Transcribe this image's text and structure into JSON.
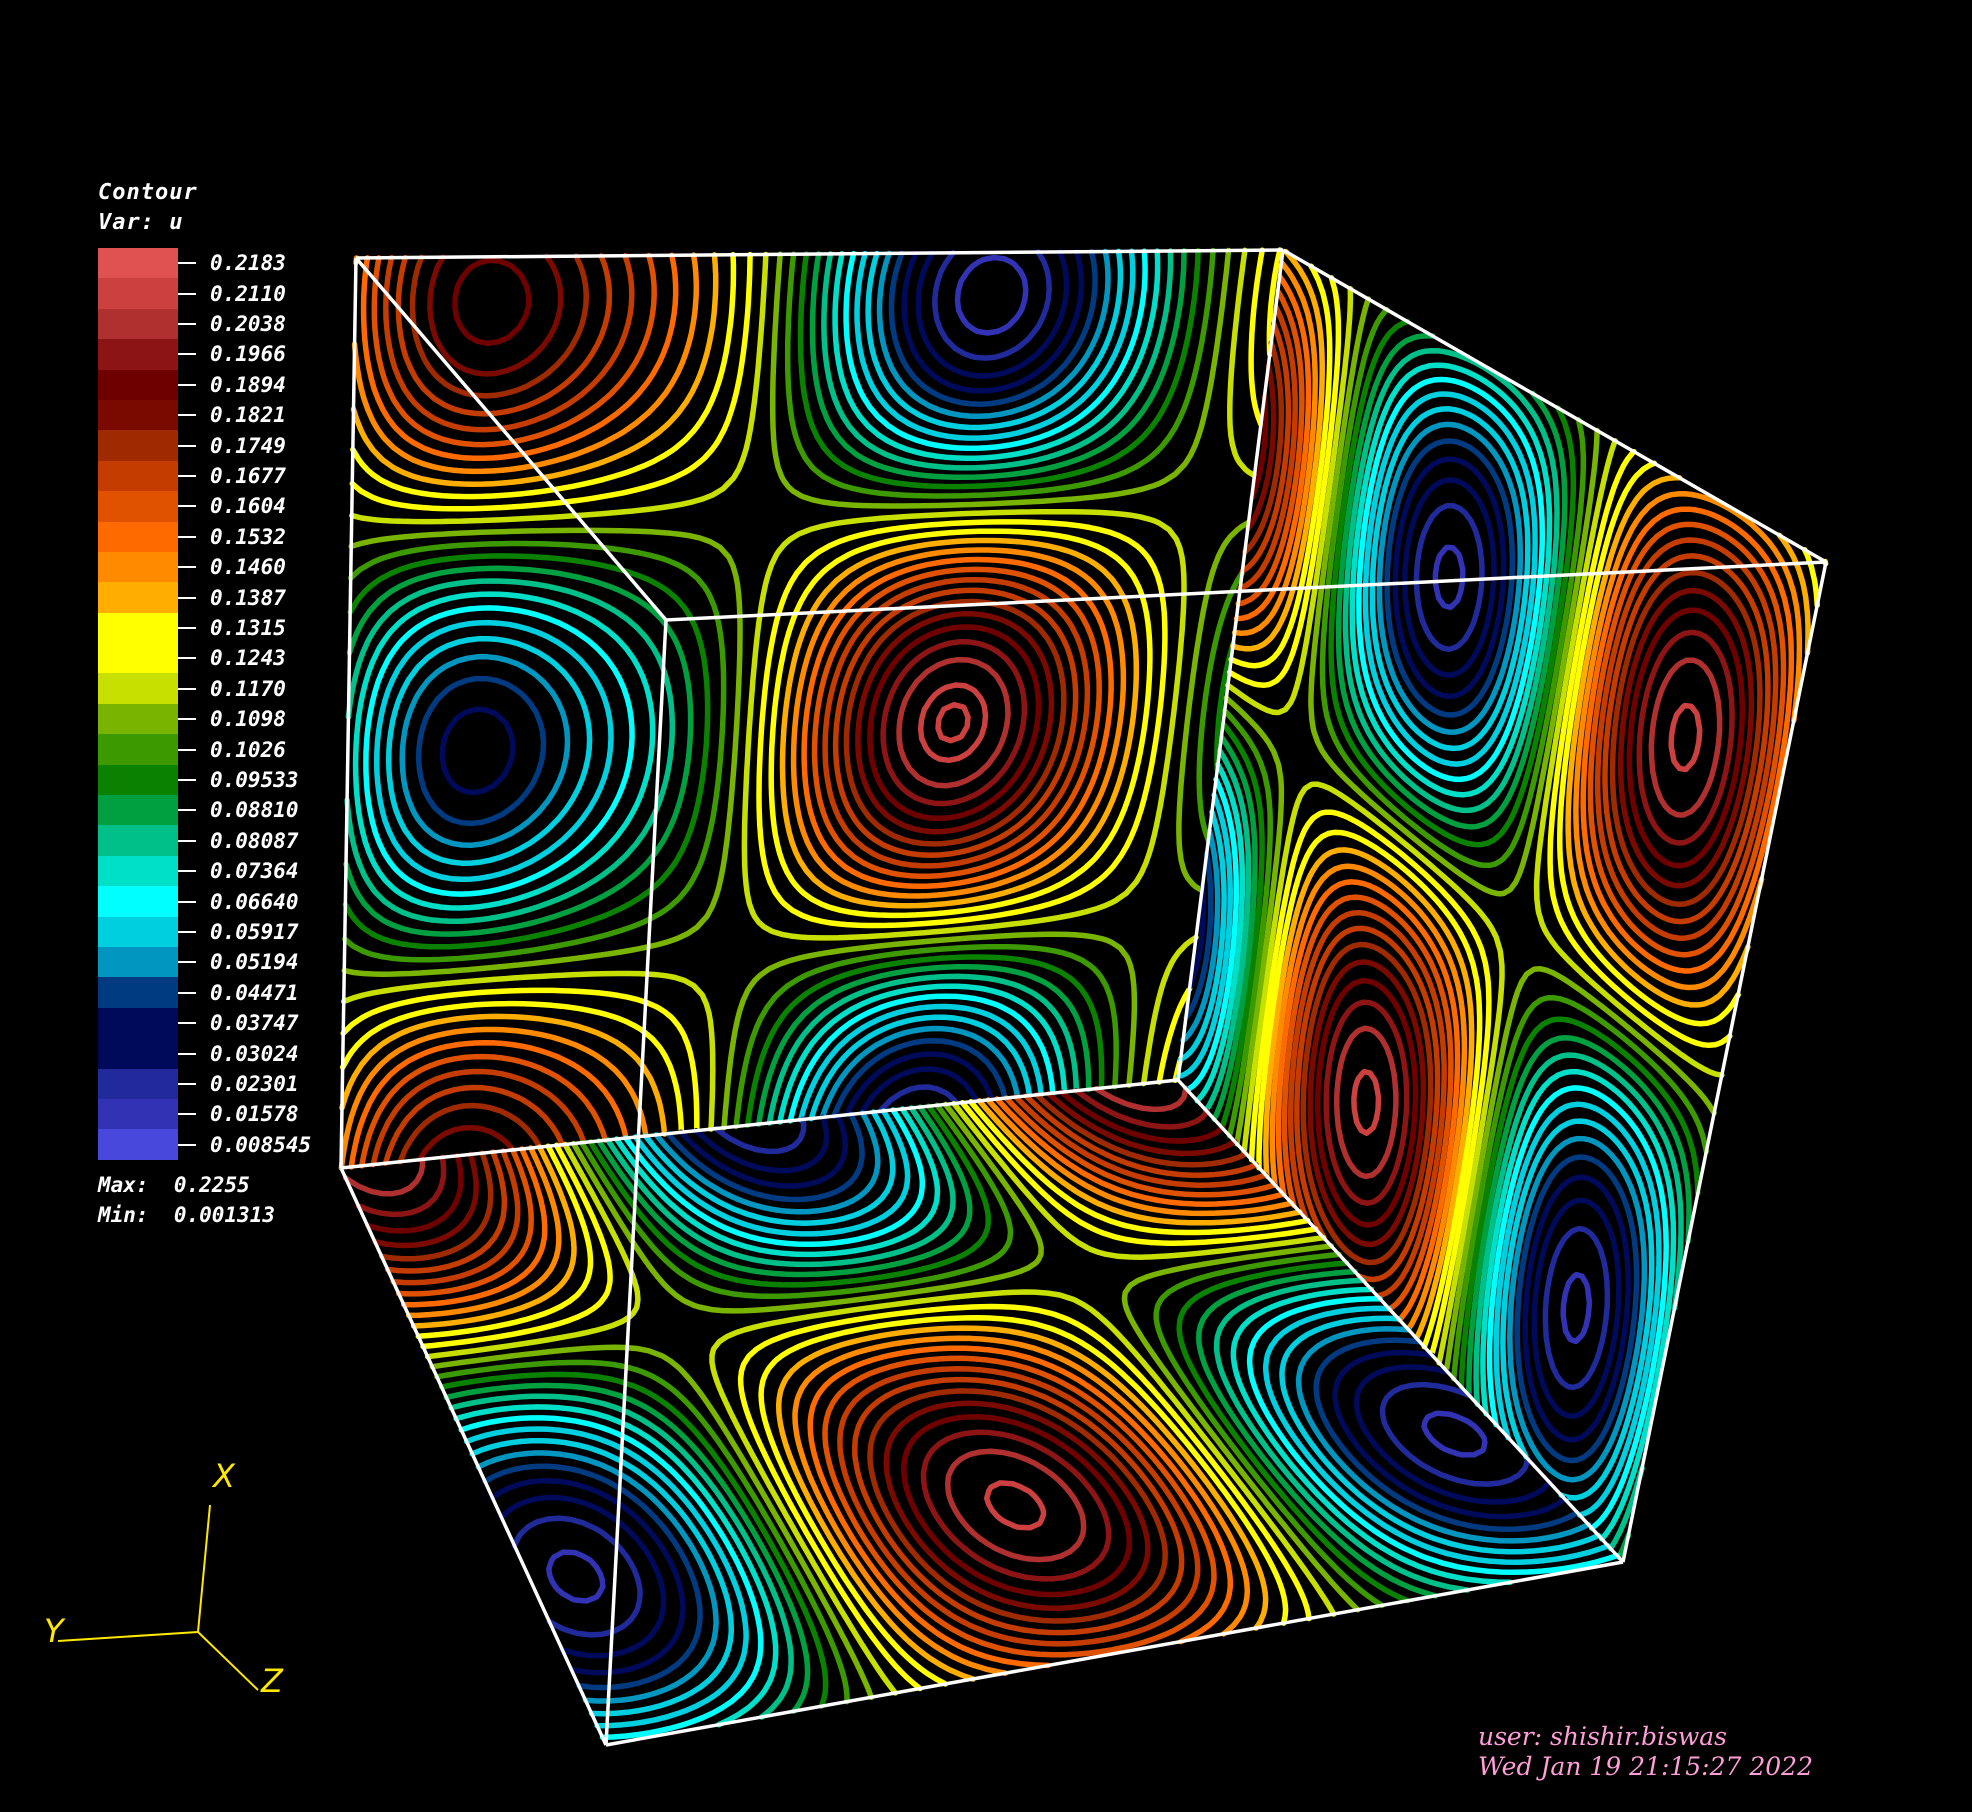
{
  "legend": {
    "title": "Contour",
    "variable": "Var: u",
    "max_label": "Max:",
    "max_value": "0.2255",
    "min_label": "Min:",
    "min_value": "0.001313",
    "levels": [
      {
        "label": "0.2183",
        "color": "#e05252"
      },
      {
        "label": "0.2110",
        "color": "#cc4040"
      },
      {
        "label": "0.2038",
        "color": "#b03030"
      },
      {
        "label": "0.1966",
        "color": "#8c1414"
      },
      {
        "label": "0.1894",
        "color": "#6e0000"
      },
      {
        "label": "0.1821",
        "color": "#7a0a00"
      },
      {
        "label": "0.1749",
        "color": "#a02a00"
      },
      {
        "label": "0.1677",
        "color": "#c43c00"
      },
      {
        "label": "0.1604",
        "color": "#e05200"
      },
      {
        "label": "0.1532",
        "color": "#ff6a00"
      },
      {
        "label": "0.1460",
        "color": "#ff8a00"
      },
      {
        "label": "0.1387",
        "color": "#ffae00"
      },
      {
        "label": "0.1315",
        "color": "#ffff00"
      },
      {
        "label": "0.1243",
        "color": "#ffff00"
      },
      {
        "label": "0.1170",
        "color": "#c8e000"
      },
      {
        "label": "0.1098",
        "color": "#78b400"
      },
      {
        "label": "0.1026",
        "color": "#3c9a00"
      },
      {
        "label": "0.09533",
        "color": "#0a8200"
      },
      {
        "label": "0.08810",
        "color": "#00a040"
      },
      {
        "label": "0.08087",
        "color": "#00c08a"
      },
      {
        "label": "0.07364",
        "color": "#00e0c8"
      },
      {
        "label": "0.06640",
        "color": "#00ffff"
      },
      {
        "label": "0.05917",
        "color": "#00cfe0"
      },
      {
        "label": "0.05194",
        "color": "#0096c0"
      },
      {
        "label": "0.04471",
        "color": "#003a80"
      },
      {
        "label": "0.03747",
        "color": "#000a5a"
      },
      {
        "label": "0.03024",
        "color": "#000a5a"
      },
      {
        "label": "0.02301",
        "color": "#202a9a"
      },
      {
        "label": "0.01578",
        "color": "#3232b4"
      },
      {
        "label": "0.008545",
        "color": "#4848dc"
      }
    ]
  },
  "chart_data": {
    "type": "heatmap",
    "plot_kind": "3D contour plot on cube faces",
    "variable": "u",
    "max": 0.2255,
    "min": 0.001313,
    "levels": [
      0.2183,
      0.211,
      0.2038,
      0.1966,
      0.1894,
      0.1821,
      0.1749,
      0.1677,
      0.1604,
      0.1532,
      0.146,
      0.1387,
      0.1315,
      0.1243,
      0.117,
      0.1098,
      0.1026,
      0.09533,
      0.0881,
      0.08087,
      0.07364,
      0.0664,
      0.05917,
      0.05194,
      0.04471,
      0.03747,
      0.03024,
      0.02301,
      0.01578,
      0.008545
    ],
    "axes": [
      "X",
      "Y",
      "Z"
    ]
  },
  "triad": {
    "x": "X",
    "y": "Y",
    "z": "Z",
    "color": "#ffe800"
  },
  "user_info": {
    "user": "user: shishir.biswas",
    "date": "Wed Jan 19 21:15:27 2022"
  }
}
